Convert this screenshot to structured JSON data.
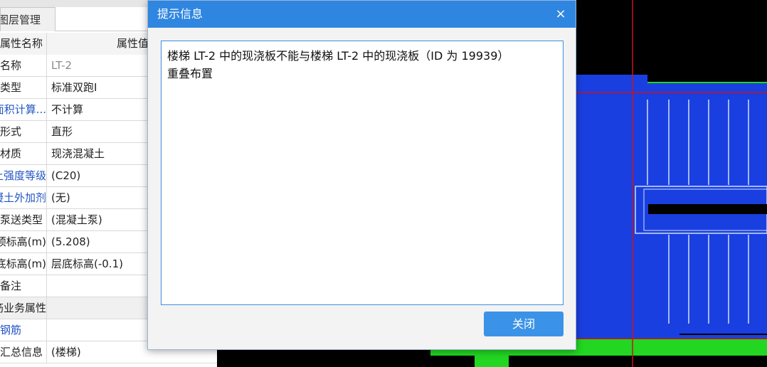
{
  "panel": {
    "tab_label": "图层管理",
    "header": {
      "name_col": "属性名称",
      "value_col": "属性值"
    },
    "rows": [
      {
        "name": "名称",
        "value": "LT-2",
        "name_style": "",
        "value_style": "grey"
      },
      {
        "name": "类型",
        "value": "标准双跑I",
        "name_style": "",
        "value_style": ""
      },
      {
        "name": "建筑面积计算...",
        "value": "不计算",
        "name_style": "blue",
        "value_style": ""
      },
      {
        "name": "形式",
        "value": "直形",
        "name_style": "",
        "value_style": ""
      },
      {
        "name": "材质",
        "value": "现浇混凝土",
        "name_style": "",
        "value_style": ""
      },
      {
        "name": "混凝土强度等级",
        "value": "(C20)",
        "name_style": "blue",
        "value_style": ""
      },
      {
        "name": "混凝土外加剂",
        "value": "(无)",
        "name_style": "blue",
        "value_style": ""
      },
      {
        "name": "泵送类型",
        "value": "(混凝土泵)",
        "name_style": "",
        "value_style": ""
      },
      {
        "name": "顶标高(m)",
        "value": "(5.208)",
        "name_style": "",
        "value_style": ""
      },
      {
        "name": "底标高(m)",
        "value": "层底标高(-0.1)",
        "name_style": "",
        "value_style": ""
      },
      {
        "name": "备注",
        "value": "",
        "name_style": "",
        "value_style": ""
      },
      {
        "name": "钢筋业务属性",
        "value": "",
        "name_style": "",
        "value_style": "",
        "section": true
      },
      {
        "name": "钢筋",
        "value": "",
        "name_style": "blue",
        "value_style": ""
      },
      {
        "name": "汇总信息",
        "value": "(楼梯)",
        "name_style": "",
        "value_style": ""
      }
    ]
  },
  "dialog": {
    "title": "提示信息",
    "close_glyph": "×",
    "message_line1": "楼梯 LT-2 中的现浇板不能与楼梯 LT-2 中的现浇板（ID 为 19939）",
    "message_line2": "重叠布置",
    "button_label": "关闭"
  },
  "colors": {
    "dialog_title_bg": "#2f86e0",
    "button_bg": "#3b93e8",
    "canvas_bg": "#000000",
    "stair_blue": "#1a3fe0",
    "slab_green": "#22d622",
    "axis_red": "#c8141e"
  }
}
